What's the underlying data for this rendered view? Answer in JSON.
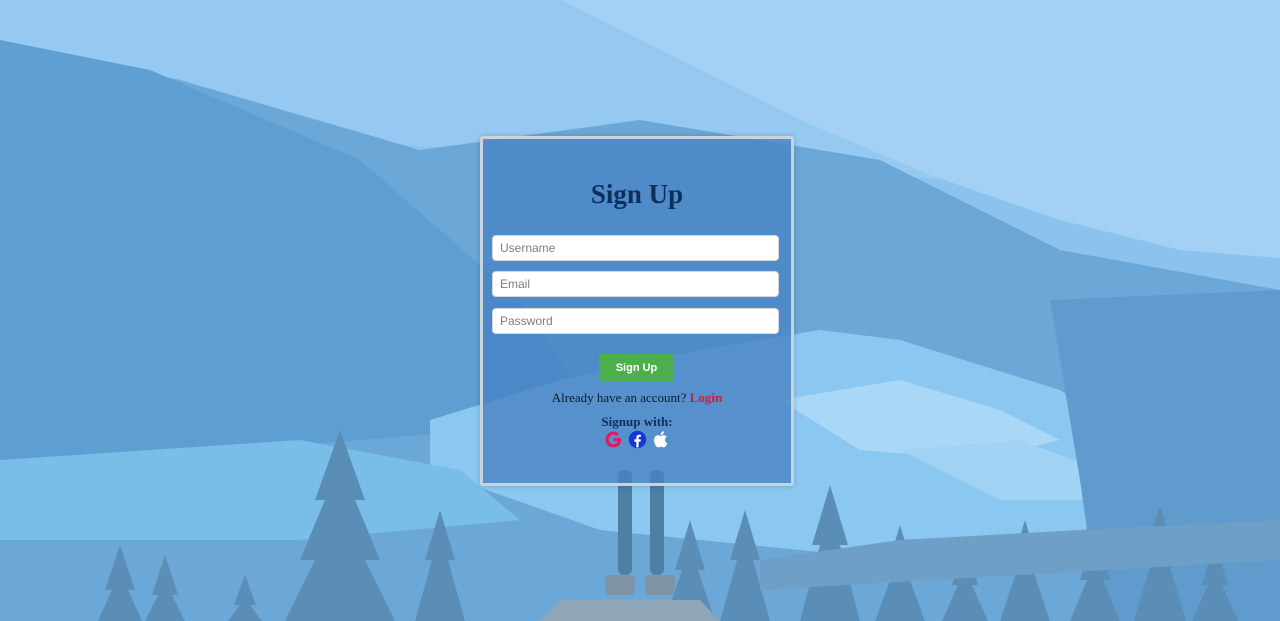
{
  "form": {
    "title": "Sign Up",
    "username_placeholder": "Username",
    "email_placeholder": "Email",
    "password_placeholder": "Password",
    "submit_label": "Sign Up",
    "login_prompt": "Already have an account? ",
    "login_link": "Login",
    "signup_with_label": "Signup with:"
  },
  "social": [
    {
      "icon": "google-icon",
      "color": "#e2185b"
    },
    {
      "icon": "facebook-icon",
      "color": "#1437d6"
    },
    {
      "icon": "apple-icon",
      "color": "#ffffff"
    }
  ],
  "colors": {
    "card_bg": "#4882c4",
    "title": "#0d2f5a",
    "button": "#4cae4c",
    "login_link": "#d11a3c"
  }
}
